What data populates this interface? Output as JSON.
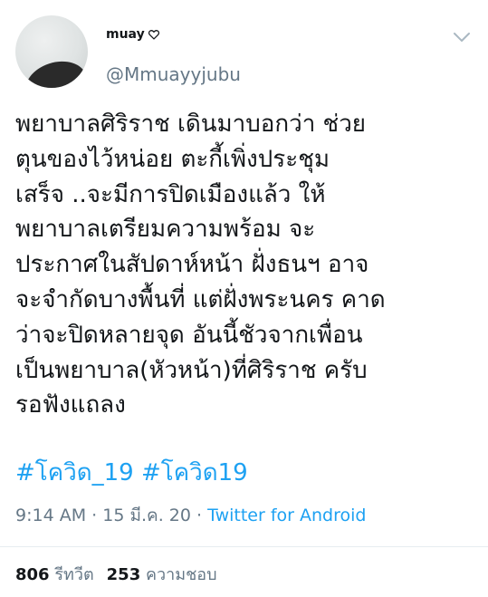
{
  "author": {
    "display_name": "muay",
    "handle": "@Mmuayyjubu"
  },
  "tweet": {
    "lines": [
      "พยาบาลศิริราช เดินมาบอกว่า ช่วย",
      "ตุนของไว้หน่อย ตะกี้เพิ่งประชุม",
      "เสร็จ ..จะมีการปิดเมืองแล้ว ให้",
      "พยาบาลเตรียมความพร้อม จะ",
      "ประกาศในสัปดาห์หน้า ฝั่งธนฯ อาจ",
      "จะจำกัดบางพื้นที่ แต่ฝั่งพระนคร คาด",
      "ว่าจะปิดหลายจุด อันนี้ชัวจากเพื่อน",
      "เป็นพยาบาล(หัวหน้า)ที่ศิริราช ครับ",
      "รอฟังแถลง"
    ],
    "hashtags": [
      "#โควิด_19",
      "#โควิด19"
    ],
    "time": "9:14 AM",
    "date": "15 มี.ค. 20",
    "source": "Twitter for Android",
    "separator": " · "
  },
  "stats": {
    "retweets": "806",
    "retweets_label": "รีทวีต",
    "likes": "253",
    "likes_label": "ความชอบ"
  },
  "colors": {
    "text": "#14171a",
    "muted": "#657786",
    "link": "#1da1f2",
    "divider": "#e6ecf0"
  },
  "icons": {
    "name_decoration": "heart-outline-icon",
    "menu": "chevron-down-icon"
  }
}
